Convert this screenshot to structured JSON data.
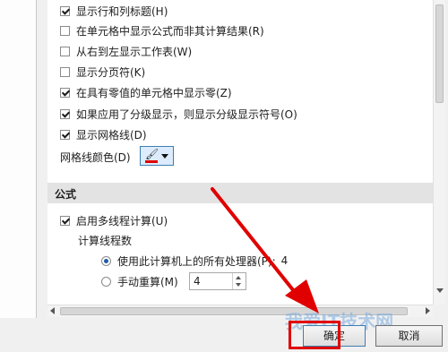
{
  "options": {
    "show_row_col_headers": {
      "label": "显示行和列标题(H)",
      "checked": true
    },
    "show_formulas": {
      "label": "在单元格中显示公式而非其计算结果(R)",
      "checked": false
    },
    "right_to_left": {
      "label": "从右到左显示工作表(W)",
      "checked": false
    },
    "show_page_breaks": {
      "label": "显示分页符(K)",
      "checked": false
    },
    "show_zero": {
      "label": "在具有零值的单元格中显示零(Z)",
      "checked": true
    },
    "show_outline_symbols": {
      "label": "如果应用了分级显示，则显示分级显示符号(O)",
      "checked": true
    },
    "show_gridlines": {
      "label": "显示网格线(D)",
      "checked": true
    },
    "gridline_color_label": "网格线颜色(D)",
    "gridline_color": "#e00000"
  },
  "formulas_section": {
    "title": "公式",
    "multithread": {
      "label": "启用多线程计算(U)",
      "checked": true
    },
    "thread_count_label": "计算线程数",
    "use_all_processors": {
      "label": "使用此计算机上的所有处理器(P):",
      "value": "4",
      "selected": true
    },
    "manual": {
      "label": "手动重算(M)",
      "value": "4",
      "selected": false
    }
  },
  "buttons": {
    "ok": "确定",
    "cancel": "取消"
  },
  "watermark": "我爱IT技术网",
  "annotation_color": "#e00000"
}
